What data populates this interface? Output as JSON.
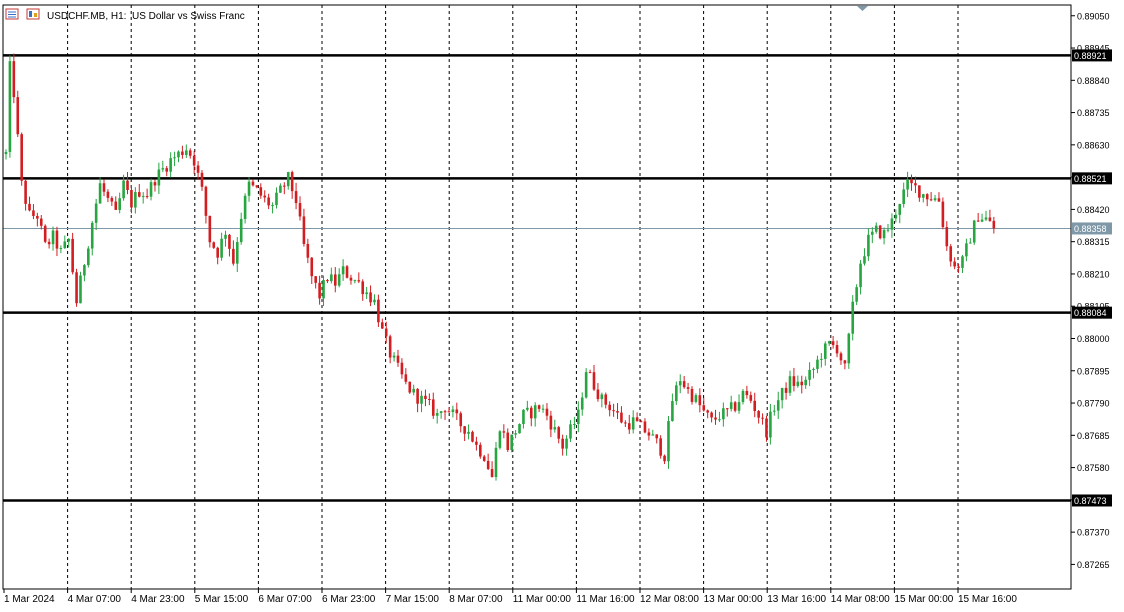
{
  "header": {
    "symbol": "USDCHF.MB, H1:",
    "description": "US Dollar vs Swiss Franc"
  },
  "colors": {
    "bull": "#26a541",
    "bear": "#d21d21",
    "grid": "#000000",
    "level_line": "#000000",
    "bid_line": "#7f98a8",
    "bid_label_bg": "#7f98a8",
    "level_label_bg": "#000000"
  },
  "chart_data": {
    "type": "candlestick",
    "ylim": [
      0.87185,
      0.89085
    ],
    "price_ticks": [
      "0.89050",
      "0.88945",
      "0.88840",
      "0.88735",
      "0.88630",
      "0.88525",
      "0.88420",
      "0.88315",
      "0.88210",
      "0.88105",
      "0.88000",
      "0.87895",
      "0.87790",
      "0.87685",
      "0.87580",
      "0.87475",
      "0.87370",
      "0.87265"
    ],
    "time_labels": [
      "1 Mar 2024",
      "4 Mar 07:00",
      "4 Mar 23:00",
      "5 Mar 15:00",
      "6 Mar 07:00",
      "6 Mar 23:00",
      "7 Mar 15:00",
      "8 Mar 07:00",
      "11 Mar 00:00",
      "11 Mar 16:00",
      "12 Mar 08:00",
      "13 Mar 00:00",
      "13 Mar 16:00",
      "14 Mar 08:00",
      "15 Mar 00:00",
      "15 Mar 16:00"
    ],
    "levels": [
      "0.88921",
      "0.88521",
      "0.88084",
      "0.87473"
    ],
    "bid": "0.88358",
    "anchors": [
      [
        0,
        0.886
      ],
      [
        1,
        0.8888
      ],
      [
        2,
        0.888
      ],
      [
        4,
        0.885
      ],
      [
        6,
        0.884
      ],
      [
        8,
        0.884
      ],
      [
        10,
        0.883
      ],
      [
        12,
        0.8833
      ],
      [
        14,
        0.8828
      ],
      [
        16,
        0.8832
      ],
      [
        18,
        0.8812
      ],
      [
        20,
        0.8825
      ],
      [
        22,
        0.8838
      ],
      [
        24,
        0.885
      ],
      [
        26,
        0.8845
      ],
      [
        28,
        0.884
      ],
      [
        30,
        0.885
      ],
      [
        32,
        0.8844
      ],
      [
        34,
        0.8848
      ],
      [
        36,
        0.8847
      ],
      [
        38,
        0.8852
      ],
      [
        40,
        0.8855
      ],
      [
        42,
        0.8858
      ],
      [
        44,
        0.886
      ],
      [
        46,
        0.8862
      ],
      [
        48,
        0.8858
      ],
      [
        50,
        0.8848
      ],
      [
        52,
        0.8832
      ],
      [
        54,
        0.8828
      ],
      [
        56,
        0.8835
      ],
      [
        58,
        0.8825
      ],
      [
        60,
        0.884
      ],
      [
        62,
        0.885
      ],
      [
        64,
        0.8848
      ],
      [
        66,
        0.8845
      ],
      [
        68,
        0.8843
      ],
      [
        70,
        0.8848
      ],
      [
        72,
        0.8852
      ],
      [
        74,
        0.8845
      ],
      [
        76,
        0.883
      ],
      [
        78,
        0.882
      ],
      [
        80,
        0.8814
      ],
      [
        82,
        0.882
      ],
      [
        84,
        0.8818
      ],
      [
        86,
        0.8822
      ],
      [
        88,
        0.882
      ],
      [
        90,
        0.8818
      ],
      [
        92,
        0.8815
      ],
      [
        94,
        0.8812
      ],
      [
        96,
        0.8802
      ],
      [
        98,
        0.8795
      ],
      [
        100,
        0.879
      ],
      [
        102,
        0.8785
      ],
      [
        104,
        0.8782
      ],
      [
        106,
        0.878
      ],
      [
        108,
        0.8778
      ],
      [
        110,
        0.8775
      ],
      [
        112,
        0.8778
      ],
      [
        114,
        0.8775
      ],
      [
        116,
        0.8772
      ],
      [
        118,
        0.877
      ],
      [
        120,
        0.8765
      ],
      [
        122,
        0.8762
      ],
      [
        124,
        0.8755
      ],
      [
        126,
        0.8772
      ],
      [
        128,
        0.8765
      ],
      [
        130,
        0.877
      ],
      [
        132,
        0.8775
      ],
      [
        134,
        0.8776
      ],
      [
        136,
        0.8778
      ],
      [
        138,
        0.8775
      ],
      [
        140,
        0.877
      ],
      [
        142,
        0.8765
      ],
      [
        144,
        0.877
      ],
      [
        146,
        0.8775
      ],
      [
        148,
        0.879
      ],
      [
        150,
        0.8785
      ],
      [
        152,
        0.878
      ],
      [
        154,
        0.8778
      ],
      [
        156,
        0.8775
      ],
      [
        158,
        0.8772
      ],
      [
        160,
        0.8773
      ],
      [
        162,
        0.8771
      ],
      [
        164,
        0.8769
      ],
      [
        166,
        0.8766
      ],
      [
        168,
        0.8762
      ],
      [
        170,
        0.878
      ],
      [
        172,
        0.8787
      ],
      [
        174,
        0.8783
      ],
      [
        176,
        0.878
      ],
      [
        178,
        0.8776
      ],
      [
        180,
        0.8773
      ],
      [
        182,
        0.8775
      ],
      [
        184,
        0.8776
      ],
      [
        186,
        0.8778
      ],
      [
        188,
        0.8782
      ],
      [
        190,
        0.878
      ],
      [
        192,
        0.8775
      ],
      [
        194,
        0.877
      ],
      [
        196,
        0.8778
      ],
      [
        198,
        0.8782
      ],
      [
        200,
        0.8786
      ],
      [
        202,
        0.8785
      ],
      [
        204,
        0.8786
      ],
      [
        206,
        0.879
      ],
      [
        208,
        0.8795
      ],
      [
        210,
        0.8798
      ],
      [
        212,
        0.8797
      ],
      [
        214,
        0.879
      ],
      [
        216,
        0.881
      ],
      [
        218,
        0.8825
      ],
      [
        220,
        0.8832
      ],
      [
        222,
        0.8835
      ],
      [
        224,
        0.8834
      ],
      [
        226,
        0.8838
      ],
      [
        228,
        0.8845
      ],
      [
        230,
        0.885
      ],
      [
        232,
        0.8849
      ],
      [
        234,
        0.8847
      ],
      [
        236,
        0.8846
      ],
      [
        238,
        0.8845
      ],
      [
        240,
        0.883
      ],
      [
        242,
        0.8823
      ],
      [
        244,
        0.8825
      ],
      [
        246,
        0.8833
      ],
      [
        248,
        0.884
      ],
      [
        250,
        0.8839
      ],
      [
        252,
        0.88358
      ]
    ]
  }
}
